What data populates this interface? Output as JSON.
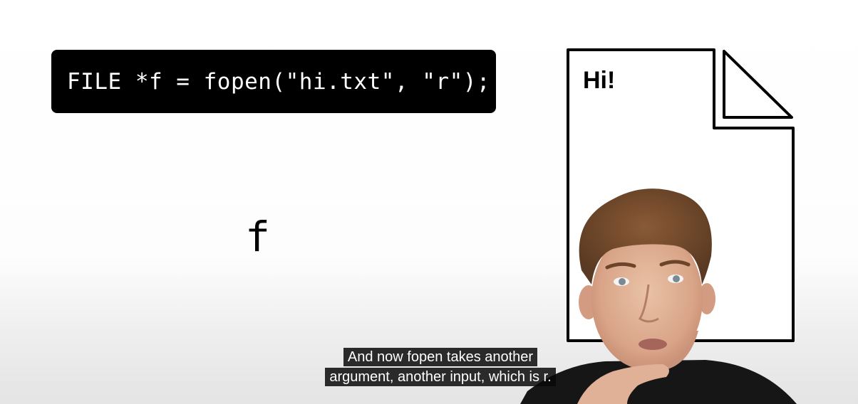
{
  "code": {
    "text": "FILE *f = fopen(\"hi.txt\", \"r\");"
  },
  "variable": {
    "label": "f"
  },
  "file": {
    "content": "Hi!"
  },
  "captions": {
    "line1": "And now fopen takes another",
    "line2": "argument, another input, which is r."
  },
  "colors": {
    "code_bg": "#000000",
    "code_fg": "#ffffff",
    "caption_bg": "#080808"
  }
}
